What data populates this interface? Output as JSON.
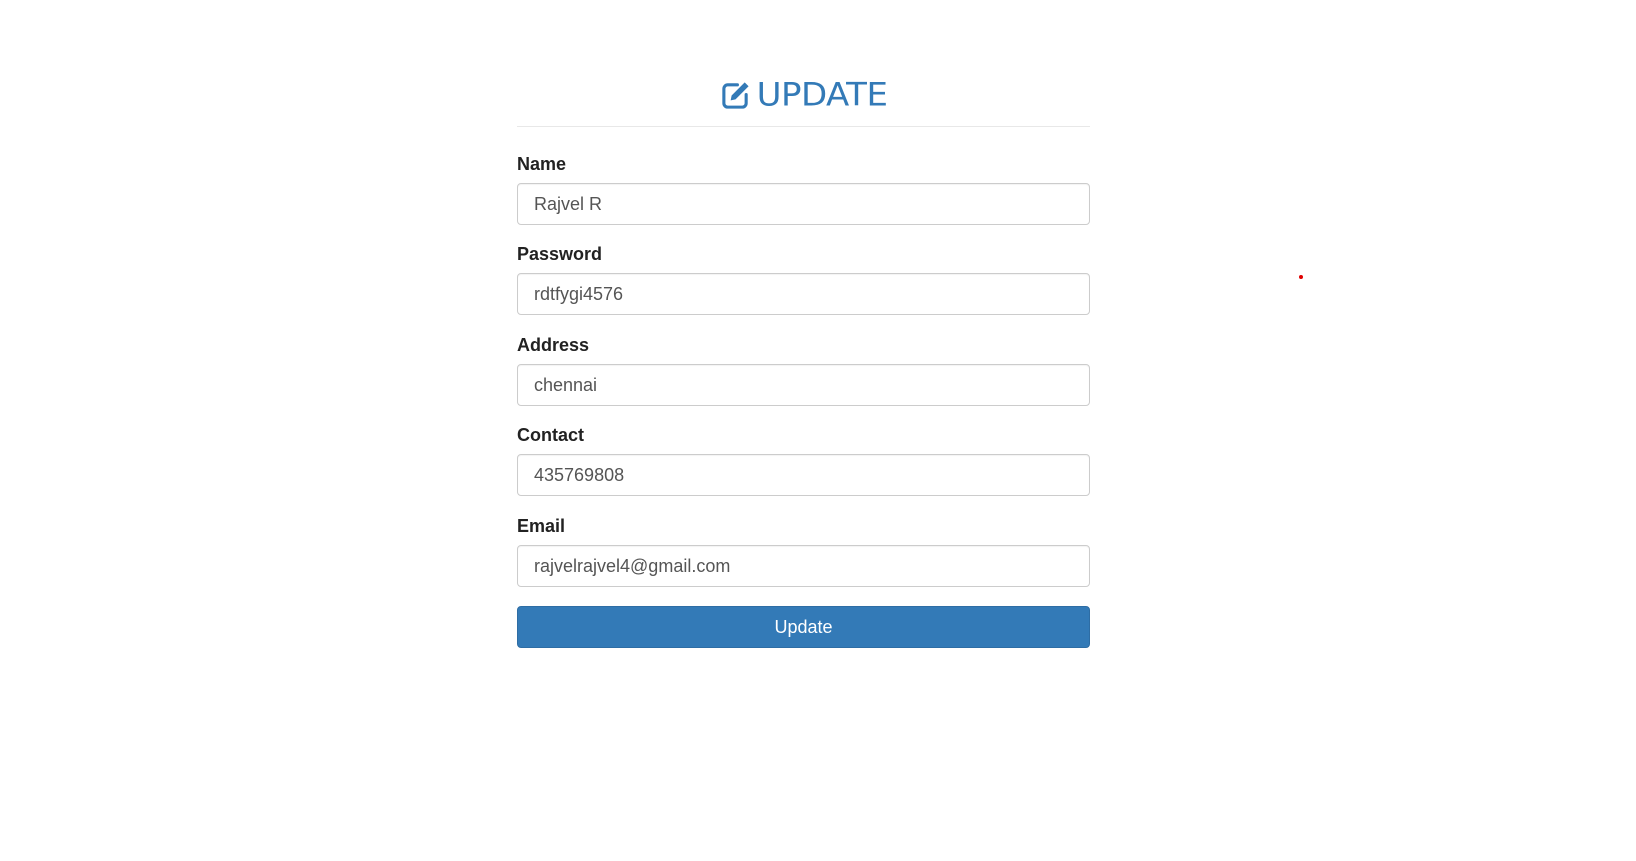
{
  "header": {
    "title": "UPDATE",
    "icon": "edit-icon",
    "color": "#337ab7"
  },
  "form": {
    "fields": [
      {
        "label": "Name",
        "value": "Rajvel R"
      },
      {
        "label": "Password",
        "value": "rdtfygi4576"
      },
      {
        "label": "Address",
        "value": "chennai"
      },
      {
        "label": "Contact",
        "value": "435769808"
      },
      {
        "label": "Email",
        "value": "rajvelrajvel4@gmail.com"
      }
    ],
    "submit_label": "Update",
    "submit_color": "#337ab7"
  }
}
